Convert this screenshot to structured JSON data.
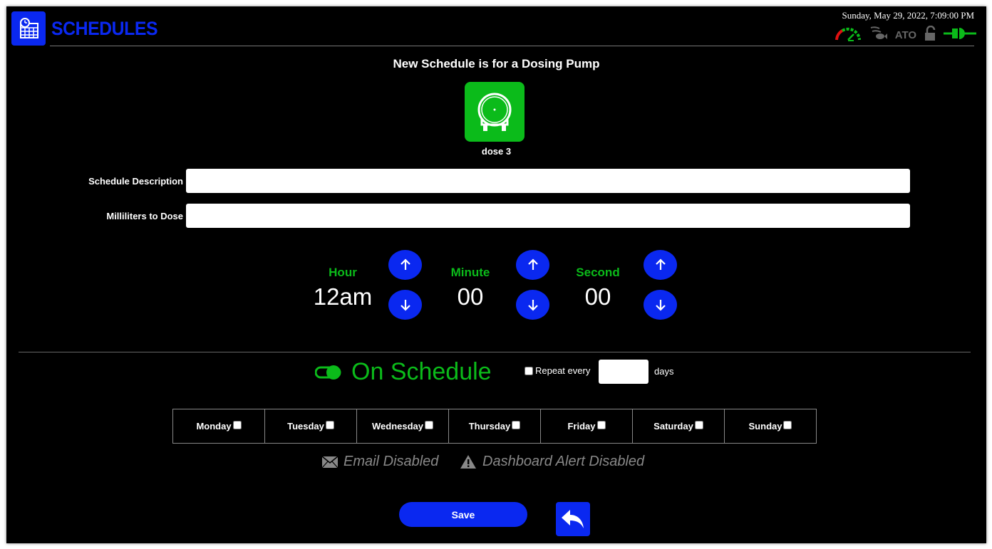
{
  "header": {
    "title": "SCHEDULES",
    "datetime": "Sunday, May 29, 2022, 7:09:00 PM",
    "status_icons": [
      "gauge-icon",
      "feed-icon",
      "ato-label",
      "unlock-icon",
      "power-plug-icon"
    ],
    "ato_label": "ATO"
  },
  "main": {
    "heading": "New Schedule is for a Dosing Pump",
    "device_icon": "dosing-pump-icon",
    "device_name": "dose 3",
    "description_label": "Schedule Description",
    "description_value": "",
    "ml_label": "Milliliters to Dose",
    "ml_value": ""
  },
  "time": {
    "hour_label": "Hour",
    "hour_value": "12am",
    "minute_label": "Minute",
    "minute_value": "00",
    "second_label": "Second",
    "second_value": "00"
  },
  "schedule": {
    "toggle_label": "On Schedule",
    "toggle_on": true,
    "repeat_label": "Repeat every",
    "repeat_value": "",
    "days_label": "days"
  },
  "weekdays": [
    "Monday",
    "Tuesday",
    "Wednesday",
    "Thursday",
    "Friday",
    "Saturday",
    "Sunday"
  ],
  "alerts": {
    "email_label": "Email Disabled",
    "dashboard_label": "Dashboard Alert Disabled"
  },
  "actions": {
    "save_label": "Save"
  },
  "colors": {
    "accent_blue": "#0a28f0",
    "accent_green": "#0bbb1a",
    "background": "#000000"
  }
}
